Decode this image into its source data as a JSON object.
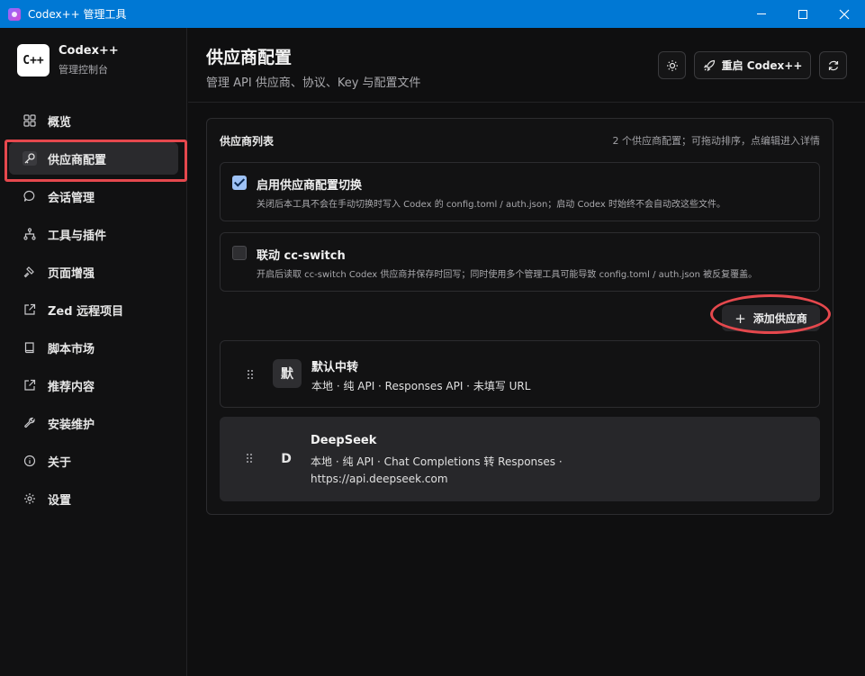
{
  "window": {
    "title": "Codex++ 管理工具"
  },
  "brand": {
    "logo": "C++",
    "name": "Codex++",
    "subtitle": "管理控制台"
  },
  "sidebar": {
    "items": [
      {
        "label": "概览",
        "icon": "grid-icon"
      },
      {
        "label": "供应商配置",
        "icon": "key-icon",
        "active": true
      },
      {
        "label": "会话管理",
        "icon": "chat-bubble-icon"
      },
      {
        "label": "工具与插件",
        "icon": "sitemap-icon"
      },
      {
        "label": "页面增强",
        "icon": "hammer-icon"
      },
      {
        "label": "Zed 远程项目",
        "icon": "external-link-icon"
      },
      {
        "label": "脚本市场",
        "icon": "book-icon"
      },
      {
        "label": "推荐内容",
        "icon": "external-link-icon"
      },
      {
        "label": "安装维护",
        "icon": "wrench-icon"
      },
      {
        "label": "关于",
        "icon": "info-icon"
      },
      {
        "label": "设置",
        "icon": "gear-icon"
      }
    ]
  },
  "header": {
    "title": "供应商配置",
    "subtitle": "管理 API 供应商、协议、Key 与配置文件",
    "restart_label": "重启 Codex++"
  },
  "panel": {
    "title": "供应商列表",
    "hint": "2 个供应商配置；可拖动排序，点编辑进入详情",
    "options": [
      {
        "title": "启用供应商配置切换",
        "desc": "关闭后本工具不会在手动切换时写入 Codex 的 config.toml / auth.json；启动 Codex 时始终不会自动改这些文件。",
        "checked": true
      },
      {
        "title": "联动 cc-switch",
        "desc": "开启后读取 cc-switch Codex 供应商并保存时回写；同时使用多个管理工具可能导致 config.toml / auth.json 被反复覆盖。",
        "checked": false
      }
    ],
    "add_label": "添加供应商",
    "providers": [
      {
        "avatar": "默",
        "name": "默认中转",
        "desc": "本地 · 纯 API · Responses API · 未填写 URL"
      },
      {
        "avatar": "D",
        "name": "DeepSeek",
        "desc": "本地 · 纯 API · Chat Completions 转 Responses · https://api.deepseek.com"
      }
    ]
  },
  "colors": {
    "titlebar": "#0078d4",
    "highlight": "#e5484d",
    "checkbox_on": "#9ec2f5"
  }
}
